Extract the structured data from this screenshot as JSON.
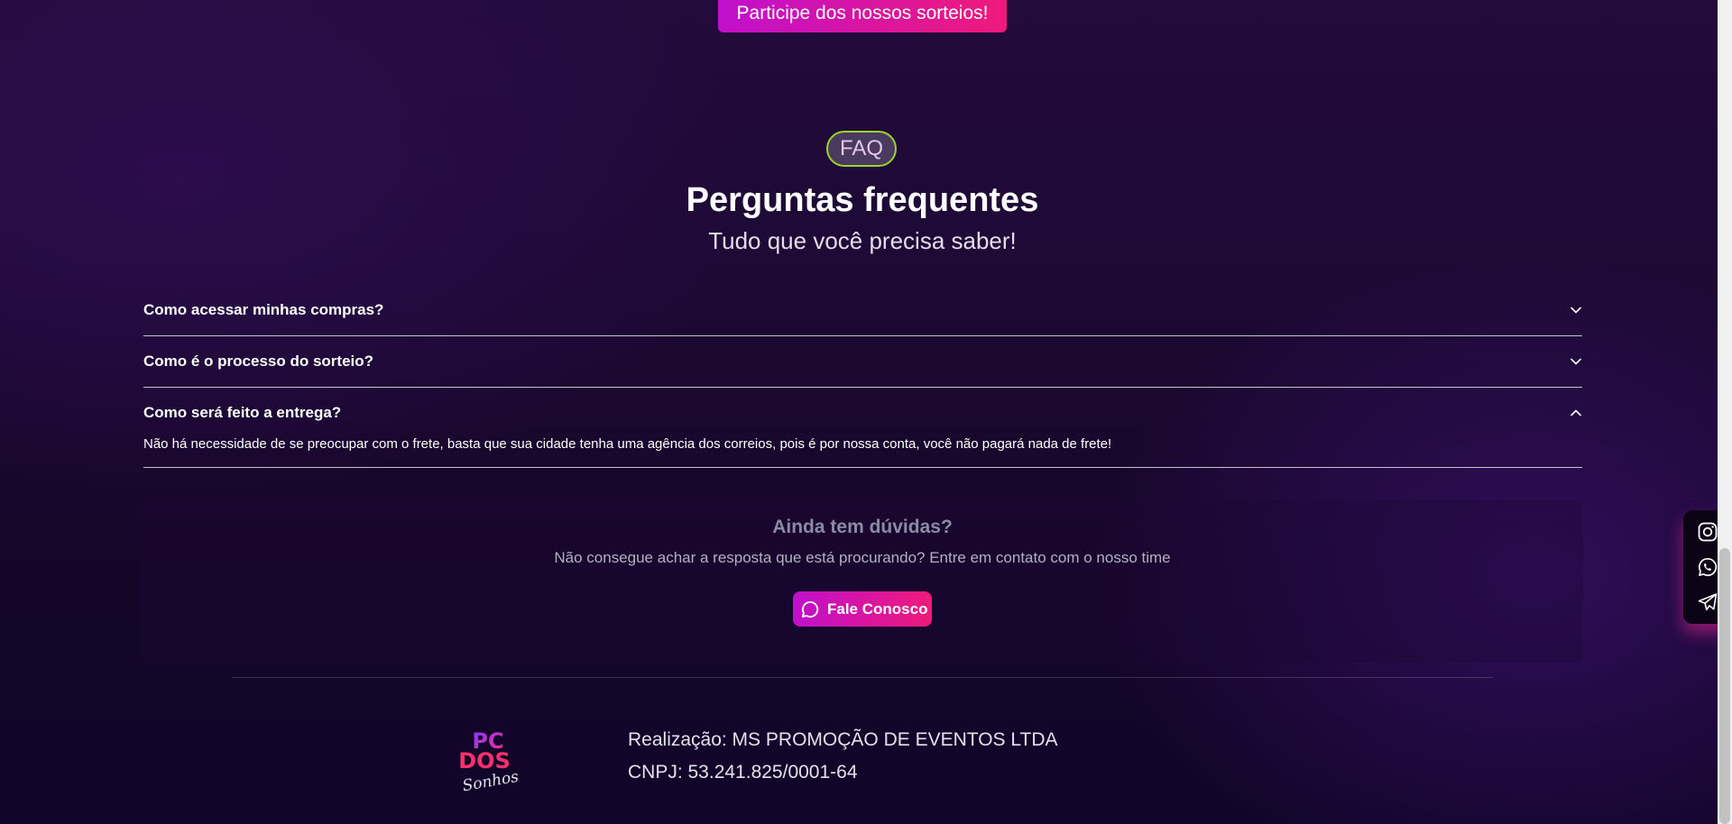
{
  "top_cta": {
    "label": "Participe dos nossos sorteios!"
  },
  "faq": {
    "badge": "FAQ",
    "title": "Perguntas frequentes",
    "subtitle": "Tudo que você precisa saber!",
    "items": [
      {
        "question": "Como acessar minhas compras?",
        "expanded": false
      },
      {
        "question": "Como é o processo do sorteio?",
        "expanded": false
      },
      {
        "question": "Como será feito a entrega?",
        "expanded": true,
        "answer": "Não há necessidade de se preocupar com o frete, basta que sua cidade tenha uma agência dos correios, pois é por nossa conta, você não pagará nada de frete!"
      }
    ]
  },
  "help": {
    "title": "Ainda tem dúvidas?",
    "text": "Não consegue achar a resposta que está procurando? Entre em contato com o nosso time",
    "button_label": "Fale Conosco",
    "button_icon": "chat-bubble-icon"
  },
  "footer": {
    "logo_text": [
      "PC",
      "DOS",
      "Sonhos"
    ],
    "line1": "Realização: MS PROMOÇÃO DE EVENTOS LTDA",
    "line2": "CNPJ: 53.241.825/0001-64"
  },
  "social": {
    "icons": [
      "instagram-icon",
      "whatsapp-icon",
      "telegram-icon"
    ]
  },
  "colors": {
    "accent_start": "#c010cc",
    "accent_end": "#ef1a7a",
    "badge_border": "#9bd42a",
    "background": "#1c0933"
  }
}
